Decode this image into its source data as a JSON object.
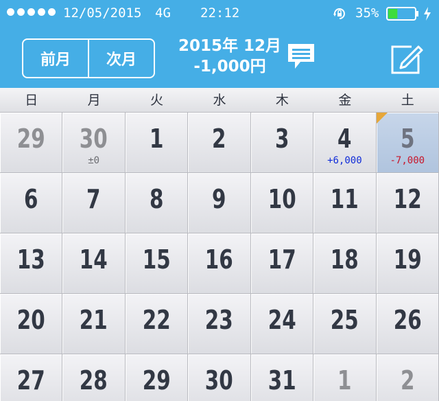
{
  "status_bar": {
    "signal_dots": 5,
    "date": "12/05/2015",
    "network": "4G",
    "time": "22:12",
    "orientation_lock_icon": "rotation-lock-icon",
    "battery_percent": "35%",
    "battery_level": 0.35,
    "battery_color": "#3ddc3d"
  },
  "header": {
    "prev_label": "前月",
    "next_label": "次月",
    "month_title": "2015年 12月",
    "total": "-1,000円",
    "comment_icon": "speech-bubble-icon",
    "edit_icon": "edit-pencil-icon",
    "bar_color": "#45aee6"
  },
  "weekdays": [
    "日",
    "月",
    "火",
    "水",
    "木",
    "金",
    "土"
  ],
  "calendar": {
    "weeks": [
      [
        {
          "day": "29",
          "other": true,
          "amount": "",
          "amount_type": ""
        },
        {
          "day": "30",
          "other": true,
          "amount": "±0",
          "amount_type": "zero"
        },
        {
          "day": "1",
          "other": false,
          "amount": "",
          "amount_type": ""
        },
        {
          "day": "2",
          "other": false,
          "amount": "",
          "amount_type": ""
        },
        {
          "day": "3",
          "other": false,
          "amount": "",
          "amount_type": ""
        },
        {
          "day": "4",
          "other": false,
          "amount": "+6,000",
          "amount_type": "pos"
        },
        {
          "day": "5",
          "other": false,
          "amount": "-7,000",
          "amount_type": "neg",
          "today": true
        }
      ],
      [
        {
          "day": "6",
          "other": false,
          "amount": "",
          "amount_type": ""
        },
        {
          "day": "7",
          "other": false,
          "amount": "",
          "amount_type": ""
        },
        {
          "day": "8",
          "other": false,
          "amount": "",
          "amount_type": ""
        },
        {
          "day": "9",
          "other": false,
          "amount": "",
          "amount_type": ""
        },
        {
          "day": "10",
          "other": false,
          "amount": "",
          "amount_type": ""
        },
        {
          "day": "11",
          "other": false,
          "amount": "",
          "amount_type": ""
        },
        {
          "day": "12",
          "other": false,
          "amount": "",
          "amount_type": ""
        }
      ],
      [
        {
          "day": "13",
          "other": false,
          "amount": "",
          "amount_type": ""
        },
        {
          "day": "14",
          "other": false,
          "amount": "",
          "amount_type": ""
        },
        {
          "day": "15",
          "other": false,
          "amount": "",
          "amount_type": ""
        },
        {
          "day": "16",
          "other": false,
          "amount": "",
          "amount_type": ""
        },
        {
          "day": "17",
          "other": false,
          "amount": "",
          "amount_type": ""
        },
        {
          "day": "18",
          "other": false,
          "amount": "",
          "amount_type": ""
        },
        {
          "day": "19",
          "other": false,
          "amount": "",
          "amount_type": ""
        }
      ],
      [
        {
          "day": "20",
          "other": false,
          "amount": "",
          "amount_type": ""
        },
        {
          "day": "21",
          "other": false,
          "amount": "",
          "amount_type": ""
        },
        {
          "day": "22",
          "other": false,
          "amount": "",
          "amount_type": ""
        },
        {
          "day": "23",
          "other": false,
          "amount": "",
          "amount_type": ""
        },
        {
          "day": "24",
          "other": false,
          "amount": "",
          "amount_type": ""
        },
        {
          "day": "25",
          "other": false,
          "amount": "",
          "amount_type": ""
        },
        {
          "day": "26",
          "other": false,
          "amount": "",
          "amount_type": ""
        }
      ],
      [
        {
          "day": "27",
          "other": false,
          "amount": "",
          "amount_type": ""
        },
        {
          "day": "28",
          "other": false,
          "amount": "",
          "amount_type": ""
        },
        {
          "day": "29",
          "other": false,
          "amount": "",
          "amount_type": ""
        },
        {
          "day": "30",
          "other": false,
          "amount": "",
          "amount_type": ""
        },
        {
          "day": "31",
          "other": false,
          "amount": "",
          "amount_type": ""
        },
        {
          "day": "1",
          "other": true,
          "amount": "",
          "amount_type": ""
        },
        {
          "day": "2",
          "other": true,
          "amount": "",
          "amount_type": ""
        }
      ]
    ],
    "colors": {
      "positive": "#0f2bd8",
      "negative": "#c8162a",
      "today_bg": "#b0c4de",
      "today_marker": "#e6a73a"
    }
  }
}
